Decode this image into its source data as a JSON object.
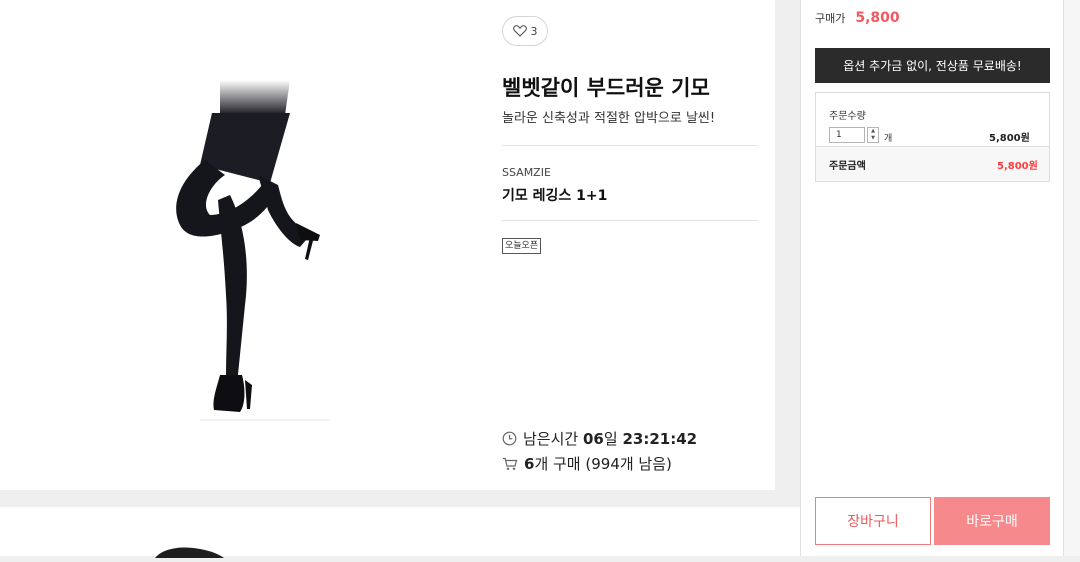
{
  "product": {
    "like_count": "3",
    "title": "벨벳같이 부드러운 기모",
    "subtitle": "놀라운 신축성과 적절한 압박으로 날씬!",
    "brand": "SSAMZIE",
    "name": "기모 레깅스 1+1",
    "badge": "오늘오픈",
    "image_alt": "black tights legs with high heels"
  },
  "timer": {
    "label": "남은시간",
    "days": "06",
    "days_unit": "일",
    "time": "23:21:42"
  },
  "sales": {
    "count": "6",
    "text": "개 구매 (994개 남음)"
  },
  "order": {
    "price_label": "구매가",
    "price": "5,800",
    "shipping_banner": "옵션 추가금 없이, 전상품 무료배송!",
    "qty_label": "주문수량",
    "qty_value": "1",
    "qty_unit": "개",
    "line_price": "5,800원",
    "total_label": "주문금액",
    "total_value": "5,800원",
    "cart_button": "장바구니",
    "buy_button": "바로구매"
  },
  "colors": {
    "accent": "#f0595d",
    "buy_button": "#f6898b",
    "banner": "#2b2b2b"
  },
  "icons": {
    "like": "heart-icon",
    "timer": "clock-icon",
    "sales": "cart-icon"
  }
}
